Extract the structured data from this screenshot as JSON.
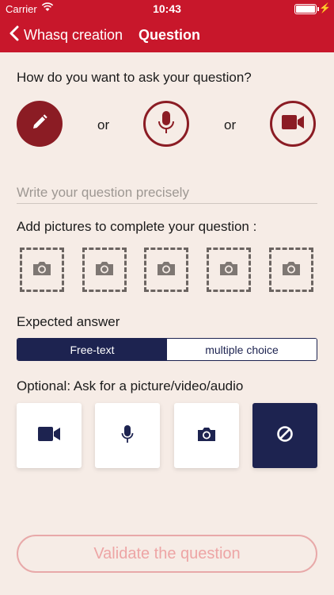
{
  "status_bar": {
    "carrier": "Carrier",
    "time": "10:43"
  },
  "nav": {
    "back_label": "Whasq creation",
    "title": "Question"
  },
  "ask_mode": {
    "prompt": "How do you want to ask your question?",
    "or_text": "or",
    "options": [
      {
        "icon": "pencil-icon",
        "state": "selected"
      },
      {
        "icon": "microphone-icon",
        "state": "unselected"
      },
      {
        "icon": "video-camera-icon",
        "state": "unselected"
      }
    ]
  },
  "question_field": {
    "placeholder": "Write your question precisely",
    "value": ""
  },
  "pictures": {
    "label": "Add pictures to complete your question :",
    "slot_count": 5,
    "slot_icon": "camera-icon"
  },
  "expected_answer": {
    "label": "Expected answer",
    "options": [
      "Free-text",
      "multiple choice"
    ],
    "selected": "Free-text"
  },
  "optional_media": {
    "label": "Optional: Ask for a picture/video/audio",
    "options": [
      {
        "icon": "video-camera-icon",
        "selected": false
      },
      {
        "icon": "microphone-icon",
        "selected": false
      },
      {
        "icon": "camera-icon",
        "selected": false
      },
      {
        "icon": "none-icon",
        "selected": true
      }
    ]
  },
  "validate_button": {
    "label": "Validate the question"
  },
  "colors": {
    "header_red": "#c8172b",
    "accent_dark_red": "#8b1c24",
    "navy": "#1d2350",
    "background": "#f6ece6",
    "disabled_pink": "#eda5a5"
  }
}
